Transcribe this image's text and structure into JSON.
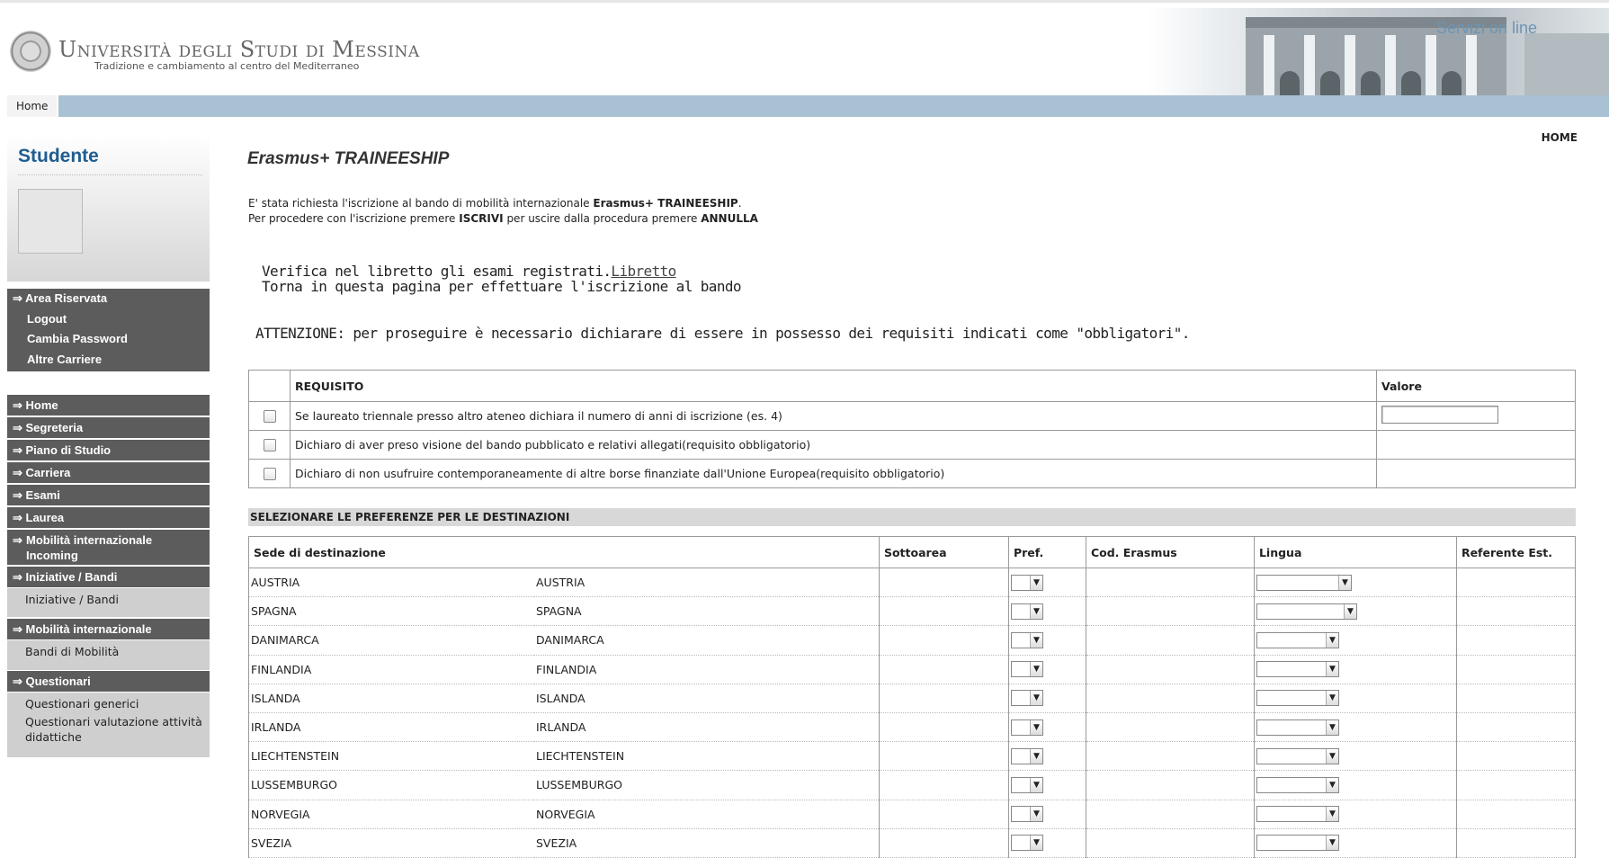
{
  "header": {
    "university": "Università degli Studi di Messina",
    "tagline": "Tradizione e cambiamento al centro del Mediterraneo",
    "servizi": "Servizi on line"
  },
  "nav": {
    "home": "Home"
  },
  "sidebar": {
    "title": "Studente",
    "reserved": [
      "Area Riservata",
      "Logout",
      "Cambia Password",
      "Altre Carriere"
    ],
    "menu": [
      {
        "label": "Home"
      },
      {
        "label": "Segreteria"
      },
      {
        "label": "Piano di Studio"
      },
      {
        "label": "Carriera"
      },
      {
        "label": "Esami"
      },
      {
        "label": "Laurea"
      },
      {
        "label": "Mobilità internazionale Incoming"
      },
      {
        "label": "Iniziative / Bandi"
      },
      {
        "label": "Mobilità internazionale"
      },
      {
        "label": "Questionari"
      }
    ],
    "subitems": {
      "iniziative": "Iniziative / Bandi",
      "mobilita": "Bandi di Mobilità",
      "questionari_1": "Questionari generici",
      "questionari_2": "Questionari valutazione attività didattiche"
    }
  },
  "main": {
    "home_link": "HOME",
    "title": "Erasmus+ TRAINEESHIP",
    "intro_line1_pre": "E' stata richiesta l'iscrizione al bando di mobilità  internazionale ",
    "intro_line1_bold": "Erasmus+ TRAINEESHIP",
    "intro_line1_post": ".",
    "intro_line2_pre": "Per procedere con l'iscrizione premere ",
    "intro_iscrivi": "ISCRIVI",
    "intro_line2_mid": " per uscire dalla procedura premere ",
    "intro_annulla": "ANNULLA",
    "verifica_text": "Verifica nel libretto gli esami registrati.",
    "libretto_link": "Libretto",
    "torna_text": "Torna in questa pagina per effettuare l'iscrizione al bando",
    "attenzione": "ATTENZIONE: per proseguire è necessario dichiarare di essere in possesso dei requisiti indicati come \"obbligatori\"."
  },
  "requisiti": {
    "col_requisito": "REQUISITO",
    "col_valore": "Valore",
    "rows": [
      "Se laureato triennale presso altro ateneo dichiara il numero di anni di iscrizione (es. 4)",
      "Dichiaro di aver preso visione del bando pubblicato e relativi allegati(requisito obbligatorio)",
      "Dichiaro di non usufruire contemporaneamente di altre borse finanziate dall'Unione Europea(requisito obbligatorio)"
    ]
  },
  "destinazioni": {
    "section_title": "SELEZIONARE LE PREFERENZE PER LE DESTINAZIONI",
    "headers": [
      "Sede di destinazione",
      "Sottoarea",
      "Pref.",
      "Cod. Erasmus",
      "Lingua",
      "Referente Est."
    ],
    "rows": [
      [
        "AUSTRIA",
        "AUSTRIA"
      ],
      [
        "SPAGNA",
        "SPAGNA"
      ],
      [
        "DANIMARCA",
        "DANIMARCA"
      ],
      [
        "FINLANDIA",
        "FINLANDIA"
      ],
      [
        "ISLANDA",
        "ISLANDA"
      ],
      [
        "IRLANDA",
        "IRLANDA"
      ],
      [
        "LIECHTENSTEIN",
        "LIECHTENSTEIN"
      ],
      [
        "LUSSEMBURGO",
        "LUSSEMBURGO"
      ],
      [
        "NORVEGIA",
        "NORVEGIA"
      ],
      [
        "SVEZIA",
        "SVEZIA"
      ]
    ]
  }
}
